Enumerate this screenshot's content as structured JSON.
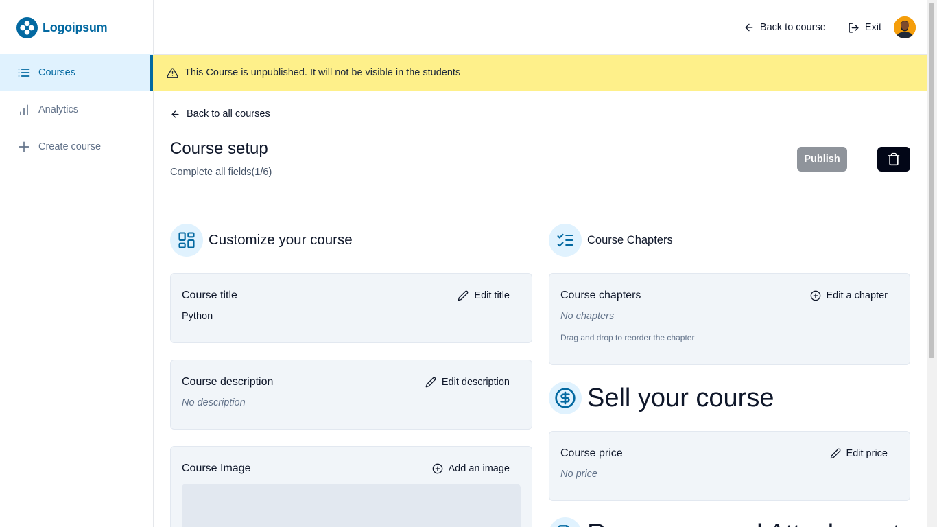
{
  "brand": {
    "name": "Logoipsum",
    "color": "#0369a1"
  },
  "sidebar": {
    "items": [
      {
        "label": "Courses",
        "icon": "list-icon",
        "active": true
      },
      {
        "label": "Analytics",
        "icon": "bar-chart-icon",
        "active": false
      },
      {
        "label": "Create course",
        "icon": "plus-icon",
        "active": false
      }
    ]
  },
  "topbar": {
    "back_to_course": "Back to course",
    "exit": "Exit"
  },
  "banner": {
    "text": "This Course is unpublished. It will not be visible in the students",
    "icon": "alert-triangle-icon"
  },
  "main": {
    "back_all": "Back to all courses",
    "title": "Course setup",
    "subtitle": "Complete all fields(1/6)",
    "publish": "Publish"
  },
  "customize": {
    "heading": "Customize your course",
    "title_card": {
      "title": "Course title",
      "action": "Edit title",
      "value": "Python"
    },
    "description_card": {
      "title": "Course description",
      "action": "Edit description",
      "value": "No description"
    },
    "image_card": {
      "title": "Course Image",
      "action": "Add an image"
    }
  },
  "chapters": {
    "heading": "Course Chapters",
    "card": {
      "title": "Course chapters",
      "action": "Edit a chapter",
      "value": "No chapters",
      "hint": "Drag and drop to reorder the chapter"
    }
  },
  "sell": {
    "heading": "Sell your course",
    "price_card": {
      "title": "Course price",
      "action": "Edit price",
      "value": "No price"
    }
  },
  "resources": {
    "heading": "Resources and Attachments"
  }
}
